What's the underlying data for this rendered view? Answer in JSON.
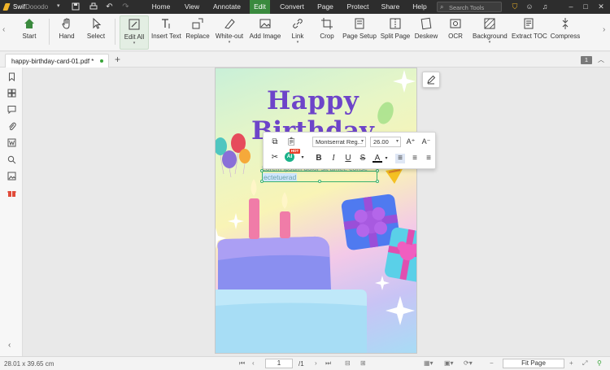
{
  "app": {
    "name_main": "Swif",
    "name_suffix": "Doo",
    "name_tail": "odo",
    "caret": "▾"
  },
  "menu": [
    "Home",
    "Annotate",
    "Edit",
    "Convert",
    "Page",
    "Protect",
    "Share",
    "Help"
  ],
  "active_menu": "Edit",
  "search": {
    "placeholder": "Search Tools"
  },
  "ribbon": {
    "start": "Start",
    "tools": [
      "Hand",
      "Select",
      "Edit All",
      "Insert Text",
      "Replace",
      "White-out",
      "Add Image",
      "Link",
      "Crop",
      "Page Setup",
      "Split Page",
      "Deskew",
      "OCR",
      "Background",
      "Extract TOC",
      "Compress"
    ]
  },
  "tab": {
    "filename": "happy-birthday-card-01.pdf *",
    "add": "+"
  },
  "page_count_badge": "1",
  "document": {
    "title_line1": "Happy",
    "title_line2": "Birthday",
    "body_line1": "Lorem ipsum dolor sit amet, conse",
    "body_line2": "ectetuerad"
  },
  "text_toolbar": {
    "font": "Montserrat Reg...",
    "size": "26.00",
    "ai_label": "AI",
    "hot_label": "HOT"
  },
  "status": {
    "dimensions": "28.01 x 39.65 cm",
    "current_page": "1",
    "total_pages": "/1",
    "zoom": "Fit Page"
  },
  "colors": {
    "accent_green": "#3a8a3e",
    "title_purple": "#6d44c9",
    "titlebar": "#2d2d2d"
  }
}
